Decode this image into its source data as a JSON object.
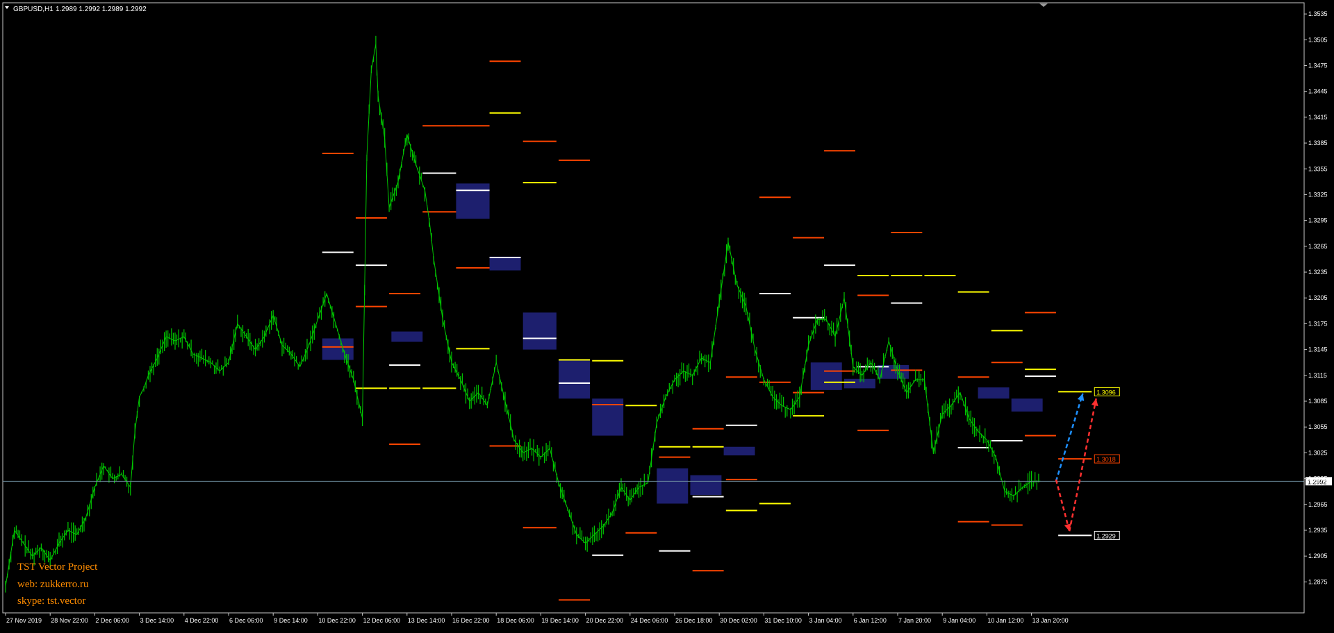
{
  "header": {
    "symbol": "GBPUSD,H1",
    "ohlc": "1.2989 1.2992 1.2989 1.2992"
  },
  "watermark": {
    "line1": "TST Vector Project",
    "line2": "web: zukkerro.ru",
    "line3": "skype: tst.vector"
  },
  "colors": {
    "background": "#000000",
    "frame": "#c8c8c8",
    "price_line_green": "#00c800",
    "current_price_line": "#6f8fa0",
    "level_red": "#ff4500",
    "level_yellow": "#ffff00",
    "level_white": "#ffffff",
    "zone_fill": "#1d1f6e",
    "arrow_blue": "#1e90ff",
    "arrow_red": "#ff3030",
    "watermark": "#ff8c00",
    "axis_text": "#ffffff"
  },
  "chart_data": {
    "type": "line",
    "instrument": "GBPUSD",
    "timeframe": "H1",
    "x_categories": [
      "27 Nov 2019",
      "28 Nov 22:00",
      "2 Dec 06:00",
      "3 Dec 14:00",
      "4 Dec 22:00",
      "6 Dec 06:00",
      "9 Dec 14:00",
      "10 Dec 22:00",
      "12 Dec 06:00",
      "13 Dec 14:00",
      "16 Dec 22:00",
      "18 Dec 06:00",
      "19 Dec 14:00",
      "20 Dec 22:00",
      "24 Dec 06:00",
      "26 Dec 18:00",
      "30 Dec 02:00",
      "31 Dec 10:00",
      "3 Jan 04:00",
      "6 Jan 12:00",
      "7 Jan 20:00",
      "9 Jan 04:00",
      "10 Jan 12:00",
      "13 Jan 20:00"
    ],
    "x_index_range": [
      0,
      23.8
    ],
    "ylim": [
      1.2839,
      1.3548
    ],
    "y_ticks": [
      "1.3535",
      "1.3505",
      "1.3475",
      "1.3445",
      "1.3415",
      "1.3385",
      "1.3355",
      "1.3325",
      "1.3295",
      "1.3265",
      "1.3235",
      "1.3205",
      "1.3175",
      "1.3145",
      "1.3115",
      "1.3085",
      "1.3055",
      "1.3025",
      "1.2995",
      "1.2965",
      "1.2935",
      "1.2905",
      "1.2875"
    ],
    "current_price": "1.2992",
    "series": [
      {
        "x": [
          0,
          0.2,
          0.4,
          0.6,
          0.8,
          1.0,
          1.2,
          1.4,
          1.6,
          1.8,
          2.0,
          2.2,
          2.4,
          2.6,
          2.8,
          2.9,
          3.0,
          3.1,
          3.2,
          3.4,
          3.6,
          3.8,
          4.0,
          4.2,
          4.4,
          4.6,
          4.8,
          5.0,
          5.2,
          5.4,
          5.6,
          5.8,
          6.0,
          6.2,
          6.4,
          6.6,
          6.8,
          7.0,
          7.2,
          7.4,
          7.6,
          7.8,
          8.0,
          8.1,
          8.2,
          8.3,
          8.35,
          8.5,
          8.6,
          8.8,
          9.0,
          9.2,
          9.4,
          9.5,
          9.6,
          9.8,
          10.0,
          10.2,
          10.4,
          10.6,
          10.8,
          11.0,
          11.2,
          11.4,
          11.6,
          11.8,
          12.0,
          12.2,
          12.4,
          12.6,
          12.8,
          13.0,
          13.2,
          13.4,
          13.6,
          13.8,
          14.0,
          14.2,
          14.4,
          14.6,
          14.8,
          15.0,
          15.2,
          15.4,
          15.6,
          15.8,
          16.0,
          16.2,
          16.4,
          16.6,
          16.8,
          17.0,
          17.2,
          17.4,
          17.6,
          17.8,
          18.0,
          18.2,
          18.4,
          18.6,
          18.8,
          19.0,
          19.2,
          19.4,
          19.6,
          19.8,
          20.0,
          20.2,
          20.4,
          20.6,
          20.8,
          21.0,
          21.2,
          21.4,
          21.6,
          21.8,
          22.0,
          22.2,
          22.4,
          22.6,
          22.8,
          23.0,
          23.2
        ],
        "y": [
          1.287,
          1.2935,
          1.292,
          1.2905,
          1.2915,
          1.29,
          1.292,
          1.2935,
          1.293,
          1.295,
          1.2985,
          1.301,
          1.2995,
          1.3,
          1.2985,
          1.305,
          1.309,
          1.31,
          1.3115,
          1.3135,
          1.316,
          1.3155,
          1.316,
          1.314,
          1.3135,
          1.313,
          1.312,
          1.313,
          1.3175,
          1.316,
          1.3145,
          1.316,
          1.3185,
          1.315,
          1.314,
          1.3125,
          1.315,
          1.318,
          1.321,
          1.3175,
          1.314,
          1.311,
          1.3065,
          1.337,
          1.347,
          1.35,
          1.344,
          1.339,
          1.331,
          1.334,
          1.3395,
          1.336,
          1.333,
          1.3295,
          1.325,
          1.318,
          1.313,
          1.311,
          1.3085,
          1.3095,
          1.308,
          1.313,
          1.3085,
          1.304,
          1.3025,
          1.303,
          1.302,
          1.303,
          1.299,
          1.296,
          1.293,
          1.292,
          1.293,
          1.294,
          1.2955,
          1.2985,
          1.297,
          1.2985,
          1.299,
          1.306,
          1.309,
          1.311,
          1.312,
          1.3115,
          1.3135,
          1.313,
          1.32,
          1.327,
          1.322,
          1.3195,
          1.3145,
          1.311,
          1.309,
          1.308,
          1.3075,
          1.309,
          1.315,
          1.318,
          1.318,
          1.316,
          1.3205,
          1.3125,
          1.3115,
          1.313,
          1.311,
          1.3155,
          1.312,
          1.3095,
          1.311,
          1.311,
          1.3025,
          1.307,
          1.308,
          1.3095,
          1.3065,
          1.305,
          1.304,
          1.302,
          1.298,
          1.2975,
          1.2985,
          1.2992,
          1.2992
        ]
      }
    ],
    "levels": [
      {
        "x1": 7.1,
        "x2": 7.8,
        "y": 1.3373,
        "color": "red"
      },
      {
        "x1": 7.1,
        "x2": 7.8,
        "y": 1.3258,
        "color": "white"
      },
      {
        "x1": 7.1,
        "x2": 7.8,
        "y": 1.3148,
        "color": "red"
      },
      {
        "x1": 7.85,
        "x2": 8.55,
        "y": 1.3298,
        "color": "red"
      },
      {
        "x1": 7.85,
        "x2": 8.55,
        "y": 1.3243,
        "color": "white"
      },
      {
        "x1": 7.85,
        "x2": 8.55,
        "y": 1.3195,
        "color": "red"
      },
      {
        "x1": 7.85,
        "x2": 8.55,
        "y": 1.31,
        "color": "yellow"
      },
      {
        "x1": 8.6,
        "x2": 9.3,
        "y": 1.321,
        "color": "red"
      },
      {
        "x1": 8.6,
        "x2": 9.3,
        "y": 1.3127,
        "color": "white"
      },
      {
        "x1": 8.6,
        "x2": 9.3,
        "y": 1.31,
        "color": "yellow"
      },
      {
        "x1": 8.6,
        "x2": 9.3,
        "y": 1.3035,
        "color": "red"
      },
      {
        "x1": 9.35,
        "x2": 10.1,
        "y": 1.31,
        "color": "yellow"
      },
      {
        "x1": 9.35,
        "x2": 10.1,
        "y": 1.3405,
        "color": "red"
      },
      {
        "x1": 9.35,
        "x2": 10.1,
        "y": 1.335,
        "color": "white"
      },
      {
        "x1": 9.35,
        "x2": 10.1,
        "y": 1.3305,
        "color": "red"
      },
      {
        "x1": 10.1,
        "x2": 10.85,
        "y": 1.3405,
        "color": "red"
      },
      {
        "x1": 10.1,
        "x2": 10.85,
        "y": 1.333,
        "color": "white"
      },
      {
        "x1": 10.1,
        "x2": 10.85,
        "y": 1.324,
        "color": "red"
      },
      {
        "x1": 10.1,
        "x2": 10.85,
        "y": 1.3146,
        "color": "yellow"
      },
      {
        "x1": 10.85,
        "x2": 11.55,
        "y": 1.348,
        "color": "red"
      },
      {
        "x1": 10.85,
        "x2": 11.55,
        "y": 1.342,
        "color": "yellow"
      },
      {
        "x1": 10.85,
        "x2": 11.55,
        "y": 1.3252,
        "color": "white"
      },
      {
        "x1": 10.85,
        "x2": 11.55,
        "y": 1.3033,
        "color": "red"
      },
      {
        "x1": 11.6,
        "x2": 12.35,
        "y": 1.3387,
        "color": "red"
      },
      {
        "x1": 11.6,
        "x2": 12.35,
        "y": 1.3339,
        "color": "yellow"
      },
      {
        "x1": 11.6,
        "x2": 12.35,
        "y": 1.3158,
        "color": "white"
      },
      {
        "x1": 11.6,
        "x2": 12.35,
        "y": 1.2938,
        "color": "red"
      },
      {
        "x1": 12.4,
        "x2": 13.1,
        "y": 1.3365,
        "color": "red"
      },
      {
        "x1": 12.4,
        "x2": 13.1,
        "y": 1.3133,
        "color": "yellow"
      },
      {
        "x1": 12.4,
        "x2": 13.1,
        "y": 1.3106,
        "color": "white"
      },
      {
        "x1": 12.4,
        "x2": 13.1,
        "y": 1.2854,
        "color": "red"
      },
      {
        "x1": 13.15,
        "x2": 13.85,
        "y": 1.3132,
        "color": "yellow"
      },
      {
        "x1": 13.15,
        "x2": 13.85,
        "y": 1.3081,
        "color": "red"
      },
      {
        "x1": 13.15,
        "x2": 13.85,
        "y": 1.2906,
        "color": "white"
      },
      {
        "x1": 13.9,
        "x2": 14.6,
        "y": 1.308,
        "color": "yellow"
      },
      {
        "x1": 13.9,
        "x2": 14.6,
        "y": 1.2932,
        "color": "red"
      },
      {
        "x1": 14.65,
        "x2": 15.35,
        "y": 1.3032,
        "color": "yellow"
      },
      {
        "x1": 14.65,
        "x2": 15.35,
        "y": 1.302,
        "color": "red"
      },
      {
        "x1": 14.65,
        "x2": 15.35,
        "y": 1.2911,
        "color": "white"
      },
      {
        "x1": 15.4,
        "x2": 16.1,
        "y": 1.3032,
        "color": "yellow"
      },
      {
        "x1": 15.4,
        "x2": 16.1,
        "y": 1.3053,
        "color": "red"
      },
      {
        "x1": 15.4,
        "x2": 16.1,
        "y": 1.2974,
        "color": "white"
      },
      {
        "x1": 15.4,
        "x2": 16.1,
        "y": 1.2888,
        "color": "red"
      },
      {
        "x1": 16.15,
        "x2": 16.85,
        "y": 1.3057,
        "color": "white"
      },
      {
        "x1": 16.15,
        "x2": 16.85,
        "y": 1.3113,
        "color": "red"
      },
      {
        "x1": 16.15,
        "x2": 16.85,
        "y": 1.2994,
        "color": "red"
      },
      {
        "x1": 16.15,
        "x2": 16.85,
        "y": 1.2958,
        "color": "yellow"
      },
      {
        "x1": 16.9,
        "x2": 17.6,
        "y": 1.3322,
        "color": "red"
      },
      {
        "x1": 16.9,
        "x2": 17.6,
        "y": 1.321,
        "color": "white"
      },
      {
        "x1": 16.9,
        "x2": 17.6,
        "y": 1.3107,
        "color": "red"
      },
      {
        "x1": 16.9,
        "x2": 17.6,
        "y": 1.2966,
        "color": "yellow"
      },
      {
        "x1": 17.65,
        "x2": 18.35,
        "y": 1.3275,
        "color": "red"
      },
      {
        "x1": 17.65,
        "x2": 18.35,
        "y": 1.3182,
        "color": "white"
      },
      {
        "x1": 17.65,
        "x2": 18.35,
        "y": 1.3095,
        "color": "red"
      },
      {
        "x1": 17.65,
        "x2": 18.35,
        "y": 1.3068,
        "color": "yellow"
      },
      {
        "x1": 18.35,
        "x2": 19.05,
        "y": 1.3376,
        "color": "red"
      },
      {
        "x1": 18.35,
        "x2": 19.05,
        "y": 1.3243,
        "color": "white"
      },
      {
        "x1": 18.35,
        "x2": 19.05,
        "y": 1.312,
        "color": "red"
      },
      {
        "x1": 18.35,
        "x2": 19.05,
        "y": 1.3107,
        "color": "yellow"
      },
      {
        "x1": 19.1,
        "x2": 19.8,
        "y": 1.3231,
        "color": "yellow"
      },
      {
        "x1": 19.1,
        "x2": 19.8,
        "y": 1.3208,
        "color": "red"
      },
      {
        "x1": 19.1,
        "x2": 19.8,
        "y": 1.3125,
        "color": "white"
      },
      {
        "x1": 19.1,
        "x2": 19.8,
        "y": 1.3051,
        "color": "red"
      },
      {
        "x1": 19.85,
        "x2": 20.55,
        "y": 1.3281,
        "color": "red"
      },
      {
        "x1": 19.85,
        "x2": 20.55,
        "y": 1.3231,
        "color": "yellow"
      },
      {
        "x1": 19.85,
        "x2": 20.55,
        "y": 1.3199,
        "color": "white"
      },
      {
        "x1": 19.85,
        "x2": 20.55,
        "y": 1.3121,
        "color": "red"
      },
      {
        "x1": 20.6,
        "x2": 21.3,
        "y": 1.3231,
        "color": "yellow"
      },
      {
        "x1": 21.35,
        "x2": 22.05,
        "y": 1.3212,
        "color": "yellow"
      },
      {
        "x1": 21.35,
        "x2": 22.05,
        "y": 1.3113,
        "color": "red"
      },
      {
        "x1": 21.35,
        "x2": 22.05,
        "y": 1.3031,
        "color": "white"
      },
      {
        "x1": 21.35,
        "x2": 22.05,
        "y": 1.2945,
        "color": "red"
      },
      {
        "x1": 22.1,
        "x2": 22.8,
        "y": 1.3167,
        "color": "yellow"
      },
      {
        "x1": 22.1,
        "x2": 22.8,
        "y": 1.313,
        "color": "red"
      },
      {
        "x1": 22.1,
        "x2": 22.8,
        "y": 1.3039,
        "color": "white"
      },
      {
        "x1": 22.1,
        "x2": 22.8,
        "y": 1.2941,
        "color": "red"
      },
      {
        "x1": 22.85,
        "x2": 23.55,
        "y": 1.3188,
        "color": "red"
      },
      {
        "x1": 22.85,
        "x2": 23.55,
        "y": 1.3122,
        "color": "yellow"
      },
      {
        "x1": 22.85,
        "x2": 23.55,
        "y": 1.3114,
        "color": "white"
      },
      {
        "x1": 22.85,
        "x2": 23.55,
        "y": 1.3045,
        "color": "red"
      },
      {
        "x1": 23.6,
        "x2": 24.35,
        "y": 1.3096,
        "color": "yellow"
      },
      {
        "x1": 23.6,
        "x2": 24.35,
        "y": 1.3018,
        "color": "red"
      },
      {
        "x1": 23.6,
        "x2": 24.35,
        "y": 1.2929,
        "color": "white"
      }
    ],
    "zones": [
      {
        "x1": 7.1,
        "x2": 7.8,
        "y_top": 1.3158,
        "y_bottom": 1.3133
      },
      {
        "x1": 8.65,
        "x2": 9.35,
        "y_top": 1.3166,
        "y_bottom": 1.3154
      },
      {
        "x1": 10.1,
        "x2": 10.85,
        "y_top": 1.3338,
        "y_bottom": 1.3297
      },
      {
        "x1": 10.85,
        "x2": 11.55,
        "y_top": 1.3253,
        "y_bottom": 1.3237
      },
      {
        "x1": 11.6,
        "x2": 12.35,
        "y_top": 1.3188,
        "y_bottom": 1.3145
      },
      {
        "x1": 12.4,
        "x2": 13.1,
        "y_top": 1.3134,
        "y_bottom": 1.3088
      },
      {
        "x1": 13.15,
        "x2": 13.85,
        "y_top": 1.3088,
        "y_bottom": 1.3045
      },
      {
        "x1": 14.6,
        "x2": 15.3,
        "y_top": 1.3007,
        "y_bottom": 1.2966
      },
      {
        "x1": 15.35,
        "x2": 16.05,
        "y_top": 1.2999,
        "y_bottom": 1.2976
      },
      {
        "x1": 16.1,
        "x2": 16.8,
        "y_top": 1.3032,
        "y_bottom": 1.3022
      },
      {
        "x1": 18.05,
        "x2": 18.75,
        "y_top": 1.313,
        "y_bottom": 1.3098
      },
      {
        "x1": 18.8,
        "x2": 19.5,
        "y_top": 1.3111,
        "y_bottom": 1.31
      },
      {
        "x1": 19.55,
        "x2": 20.25,
        "y_top": 1.3127,
        "y_bottom": 1.3111
      },
      {
        "x1": 21.8,
        "x2": 22.5,
        "y_top": 1.3101,
        "y_bottom": 1.3088
      },
      {
        "x1": 22.55,
        "x2": 23.25,
        "y_top": 1.3088,
        "y_bottom": 1.3073
      }
    ],
    "price_labels": [
      {
        "value": "1.3096",
        "color": "yellow"
      },
      {
        "value": "1.3018",
        "color": "red"
      },
      {
        "value": "1.2929",
        "color": "white"
      }
    ],
    "forecast_arrows": [
      {
        "color": "blue",
        "x1": 23.55,
        "y1": 1.2992,
        "x2": 24.15,
        "y2": 1.3094
      },
      {
        "color": "red",
        "x1": 23.55,
        "y1": 1.2994,
        "x2": 23.85,
        "y2": 1.2934
      },
      {
        "color": "red",
        "x1": 23.85,
        "y1": 1.2934,
        "x2": 24.45,
        "y2": 1.3088
      }
    ]
  }
}
